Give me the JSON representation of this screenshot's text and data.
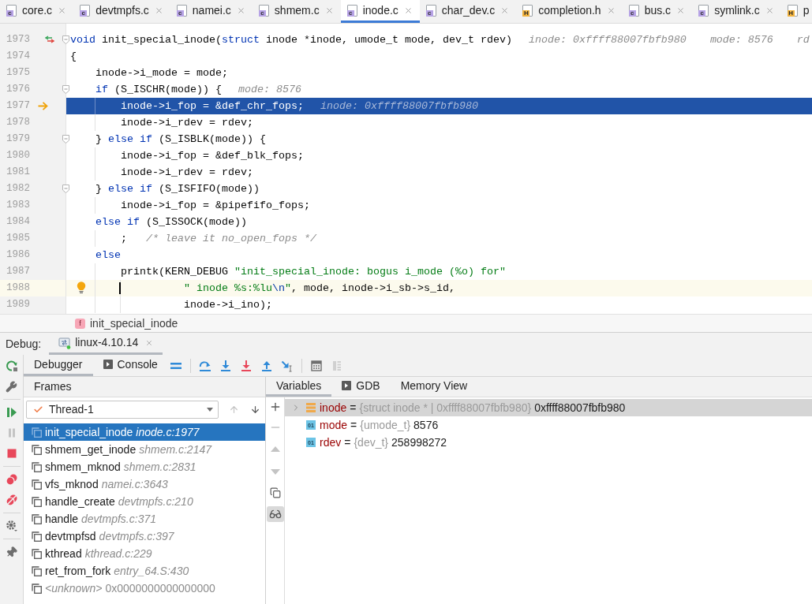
{
  "editor_tabs": [
    {
      "label": "core.c",
      "kind": "source",
      "icon_letter": "c",
      "selected": false,
      "closable": true
    },
    {
      "label": "devtmpfs.c",
      "kind": "source",
      "icon_letter": "c",
      "selected": false,
      "closable": true
    },
    {
      "label": "namei.c",
      "kind": "source",
      "icon_letter": "c",
      "selected": false,
      "closable": true
    },
    {
      "label": "shmem.c",
      "kind": "source",
      "icon_letter": "c",
      "selected": false,
      "closable": true
    },
    {
      "label": "inode.c",
      "kind": "source",
      "icon_letter": "c",
      "selected": true,
      "closable": true
    },
    {
      "label": "char_dev.c",
      "kind": "source",
      "icon_letter": "c",
      "selected": false,
      "closable": true
    },
    {
      "label": "completion.h",
      "kind": "header",
      "icon_letter": "H",
      "selected": false,
      "closable": true
    },
    {
      "label": "bus.c",
      "kind": "source",
      "icon_letter": "c",
      "selected": false,
      "closable": true
    },
    {
      "label": "symlink.c",
      "kind": "source",
      "icon_letter": "c",
      "selected": false,
      "closable": true
    },
    {
      "label": "p",
      "kind": "header",
      "icon_letter": "H",
      "selected": false,
      "closable": false
    }
  ],
  "code_lines": [
    {
      "number": "1973",
      "tokens": [
        {
          "kind": "keyword",
          "text": "void"
        },
        {
          "kind": "plain",
          "text": " init_special_inode("
        },
        {
          "kind": "keyword",
          "text": "struct"
        },
        {
          "kind": "plain",
          "text": " inode *inode, umode_t mode, dev_t rdev)"
        }
      ],
      "hints": [
        "inode: 0xffff88007fbfb980",
        "mode: 8576",
        "rd"
      ],
      "current": false,
      "caret": false,
      "fold": true,
      "related": true
    },
    {
      "number": "1974",
      "tokens": [
        {
          "kind": "plain",
          "text": "{"
        }
      ],
      "current": false,
      "caret": false,
      "fold": false,
      "related": false
    },
    {
      "number": "1975",
      "tokens": [
        {
          "kind": "plain",
          "text": "    inode->i_mode = mode;"
        }
      ],
      "current": false,
      "caret": false,
      "fold": false,
      "related": false
    },
    {
      "number": "1976",
      "tokens": [
        {
          "kind": "keyword",
          "text": "    if"
        },
        {
          "kind": "plain",
          "text": " (S_ISCHR(mode)) {"
        }
      ],
      "hints": [
        "mode: 8576"
      ],
      "current": false,
      "caret": false,
      "fold": true,
      "related": false
    },
    {
      "number": "1977",
      "tokens": [
        {
          "kind": "plain",
          "text": "        inode->i_fop = &def_chr_fops;"
        }
      ],
      "hints": [
        "inode: 0xffff88007fbfb980"
      ],
      "current": true,
      "caret": false,
      "fold": false,
      "related": false
    },
    {
      "number": "1978",
      "tokens": [
        {
          "kind": "plain",
          "text": "        inode->i_rdev = rdev;"
        }
      ],
      "current": false,
      "caret": false,
      "fold": false,
      "related": false
    },
    {
      "number": "1979",
      "tokens": [
        {
          "kind": "plain",
          "text": "    } "
        },
        {
          "kind": "keyword",
          "text": "else if"
        },
        {
          "kind": "plain",
          "text": " (S_ISBLK(mode)) {"
        }
      ],
      "current": false,
      "caret": false,
      "fold": true,
      "related": false
    },
    {
      "number": "1980",
      "tokens": [
        {
          "kind": "plain",
          "text": "        inode->i_fop = &def_blk_fops;"
        }
      ],
      "current": false,
      "caret": false,
      "fold": false,
      "related": false
    },
    {
      "number": "1981",
      "tokens": [
        {
          "kind": "plain",
          "text": "        inode->i_rdev = rdev;"
        }
      ],
      "current": false,
      "caret": false,
      "fold": false,
      "related": false
    },
    {
      "number": "1982",
      "tokens": [
        {
          "kind": "plain",
          "text": "    } "
        },
        {
          "kind": "keyword",
          "text": "else if"
        },
        {
          "kind": "plain",
          "text": " (S_ISFIFO(mode))"
        }
      ],
      "current": false,
      "caret": false,
      "fold": true,
      "related": false
    },
    {
      "number": "1983",
      "tokens": [
        {
          "kind": "plain",
          "text": "        inode->i_fop = &pipefifo_fops;"
        }
      ],
      "current": false,
      "caret": false,
      "fold": false,
      "related": false
    },
    {
      "number": "1984",
      "tokens": [
        {
          "kind": "keyword",
          "text": "    else if"
        },
        {
          "kind": "plain",
          "text": " (S_ISSOCK(mode))"
        }
      ],
      "current": false,
      "caret": false,
      "fold": false,
      "related": false
    },
    {
      "number": "1985",
      "tokens": [
        {
          "kind": "plain",
          "text": "        ;   "
        },
        {
          "kind": "comment",
          "text": "/* leave it no_open_fops */"
        }
      ],
      "current": false,
      "caret": false,
      "fold": false,
      "related": false
    },
    {
      "number": "1986",
      "tokens": [
        {
          "kind": "keyword",
          "text": "    else"
        }
      ],
      "current": false,
      "caret": false,
      "fold": false,
      "related": false
    },
    {
      "number": "1987",
      "tokens": [
        {
          "kind": "plain",
          "text": "        printk(KERN_DEBUG "
        },
        {
          "kind": "string",
          "text": "\"init_special_inode: bogus i_mode (%o) for\""
        }
      ],
      "current": false,
      "caret": false,
      "fold": false,
      "related": false
    },
    {
      "number": "1988",
      "tokens": [
        {
          "kind": "string",
          "text": "                  \" inode %s:%lu"
        },
        {
          "kind": "escape",
          "text": "\\n"
        },
        {
          "kind": "string",
          "text": "\""
        },
        {
          "kind": "plain",
          "text": ", mode, inode->i_sb->s_id,"
        }
      ],
      "current": false,
      "caret": true,
      "fold": false,
      "related": false
    },
    {
      "number": "1989",
      "tokens": [
        {
          "kind": "plain",
          "text": "                  inode->i_ino);"
        }
      ],
      "current": false,
      "caret": false,
      "fold": false,
      "related": false
    }
  ],
  "breadcrumb": {
    "badge": "f",
    "label": "init_special_inode"
  },
  "debug_header": {
    "label": "Debug:",
    "session": "linux-4.10.14"
  },
  "debug_tabs": [
    {
      "label": "Debugger",
      "kind": "plain",
      "selected": true
    },
    {
      "label": "Console",
      "kind": "console",
      "selected": false
    }
  ],
  "frames": {
    "title": "Frames",
    "thread": "Thread-1",
    "items": [
      {
        "function": "init_special_inode",
        "location": "inode.c:1977",
        "kind": "source",
        "selected": true
      },
      {
        "function": "shmem_get_inode",
        "location": "shmem.c:2147",
        "kind": "source",
        "selected": false
      },
      {
        "function": "shmem_mknod",
        "location": "shmem.c:2831",
        "kind": "source",
        "selected": false
      },
      {
        "function": "vfs_mknod",
        "location": "namei.c:3643",
        "kind": "source",
        "selected": false
      },
      {
        "function": "handle_create",
        "location": "devtmpfs.c:210",
        "kind": "source",
        "selected": false
      },
      {
        "function": "handle",
        "location": "devtmpfs.c:371",
        "kind": "source",
        "selected": false
      },
      {
        "function": "devtmpfsd",
        "location": "devtmpfs.c:397",
        "kind": "source",
        "selected": false
      },
      {
        "function": "kthread",
        "location": "kthread.c:229",
        "kind": "source",
        "selected": false
      },
      {
        "function": "ret_from_fork",
        "location": "entry_64.S:430",
        "kind": "source",
        "selected": false
      },
      {
        "function": "<unknown>",
        "location": "0x0000000000000000",
        "kind": "unknown",
        "selected": false
      }
    ]
  },
  "variables": {
    "tabs": [
      {
        "label": "Variables",
        "kind": "plain",
        "selected": true
      },
      {
        "label": "GDB",
        "kind": "console",
        "selected": false
      },
      {
        "label": "Memory View",
        "kind": "plain",
        "selected": false
      }
    ],
    "rows": [
      {
        "name": "inode",
        "operator": "=",
        "type": "{struct inode * | 0xffff88007fbfb980}",
        "value": "0xffff88007fbfb980",
        "kind": "struct",
        "expanded": false,
        "selected": true
      },
      {
        "name": "mode",
        "operator": "=",
        "type": "{umode_t}",
        "value": "8576",
        "kind": "primitive",
        "badge": "01",
        "selected": false
      },
      {
        "name": "rdev",
        "operator": "=",
        "type": "{dev_t}",
        "value": "258998272",
        "kind": "primitive",
        "badge": "01",
        "selected": false
      }
    ]
  }
}
